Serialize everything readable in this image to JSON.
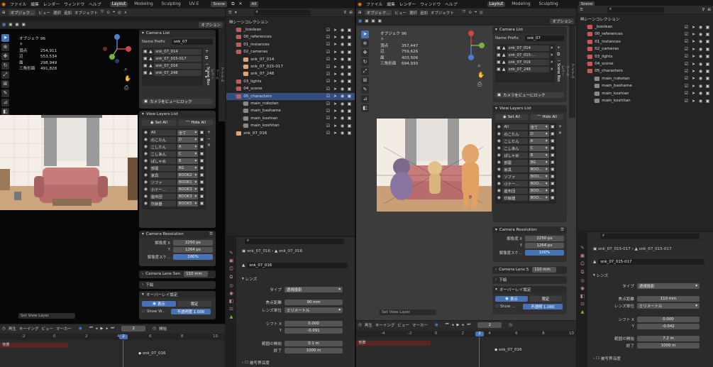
{
  "left": {
    "menu": [
      "ファイル",
      "編集",
      "レンダー",
      "ウィンドウ",
      "ヘルプ"
    ],
    "workspaces": [
      "Layout",
      "Modeling",
      "Sculpting",
      "UV E"
    ],
    "scene": "Scene",
    "view_layer": "All",
    "viewport_header": {
      "mode": "オブジェク...",
      "items": [
        "ビュー",
        "選択",
        "追加",
        "オブジェクト"
      ],
      "options": "オプション"
    },
    "stats": [
      [
        "オブジェクト",
        "96"
      ],
      [
        "頂点",
        "254,911"
      ],
      [
        "辺",
        "553,534"
      ],
      [
        "面",
        "298,949"
      ],
      [
        "三角形面",
        "491,828"
      ]
    ],
    "camera_list": {
      "title": "Camera List",
      "prefix_label": "Name Prefix",
      "prefix_value": "snk_07",
      "items": [
        "snk_07_014",
        "snk_07_015-017",
        "snk_07_016",
        "snk_07_248"
      ],
      "lock_button": "カメラをビューにロック"
    },
    "view_layers": {
      "title": "View Layers List",
      "set_all": "Set All",
      "hide_all": "Hide All",
      "items": [
        [
          "All",
          "全て"
        ],
        [
          "のこたん",
          "D"
        ],
        [
          "こしたん",
          "A"
        ],
        [
          "こしあん",
          "C"
        ],
        [
          "ぱしゃめ",
          "B"
        ],
        [
          "部屋",
          "BG"
        ],
        [
          "家具",
          "BOOK2"
        ],
        [
          "ソファ",
          "BOOK1"
        ],
        [
          "小テー...",
          "BOOK3"
        ],
        [
          "座布団",
          "BOOK3"
        ],
        [
          "炊飯器",
          "BOOK5"
        ]
      ]
    },
    "camera_resolution": {
      "title": "Camera Resolution",
      "res_x_label": "解像度 X",
      "res_x": "2250 px",
      "res_y_label": "Y",
      "res_y": "1264 px",
      "scale_label": "解像度スケ...",
      "scale": "100%"
    },
    "lens_sensor": {
      "label": "Camera Lens Sen",
      "value": "110 mm"
    },
    "shita": "下絵",
    "overlay": {
      "title": "オーバーレイ設定",
      "show": "表示",
      "limit": "限定",
      "show_w": "Show W...",
      "opacity": "不透明度 1.000"
    },
    "set_view_layer": "Set View Layer",
    "side_tabs": [
      "アイテム",
      "ツール",
      "ビュー",
      "Scene Box"
    ],
    "outliner": {
      "title": "シーンコレクション",
      "rows": [
        "_boolean",
        "00_references",
        "01_instances",
        "02_cameras",
        "snk_07_014",
        "snk_07_015-017",
        "snk_07_248",
        "03_lights",
        "04_scene",
        "05_characters",
        "main_nokotan",
        "main_bashame",
        "main_koshian",
        "main_koshitan",
        "snk_07_016"
      ]
    },
    "props": {
      "breadcrumb1": "snk_07_016",
      "breadcrumb2": "snk_07_016",
      "name": "snk_07_016",
      "lens_section": "レンズ",
      "type_label": "タイプ",
      "type_value": "透視投影",
      "focal_label": "焦点距離",
      "focal_value": "90 mm",
      "unit_label": "レンズ単位",
      "unit_value": "ミリメートル",
      "shift_label": "シフト X",
      "shift_x": "0.000",
      "y_label": "Y",
      "shift_y": "-0.091",
      "clip_start_label": "範囲の開始",
      "clip_start": "0.1 m",
      "clip_end_label": "終了",
      "clip_end": "1000 m",
      "dof": "被写界深度"
    },
    "timeline": {
      "items": [
        "再生",
        "キーイング",
        "ビュー",
        "マーカー"
      ],
      "frame": "2",
      "start": "開始",
      "marker_label": "snk_07_016",
      "track": "背景",
      "ticks": [
        "-2",
        "0",
        "2",
        "4",
        "6",
        "8",
        "10"
      ]
    }
  },
  "right": {
    "menu": [
      "ファイル",
      "編集",
      "レンダー",
      "ウィンドウ",
      "ヘルプ"
    ],
    "workspaces": [
      "Layout",
      "Modeling",
      "Sculpting"
    ],
    "scene": "Scene",
    "viewport_header": {
      "mode": "オブジェク...",
      "items": [
        "ビュー",
        "選択",
        "追加",
        "オブジェクト"
      ],
      "options": "オプション"
    },
    "stats": [
      [
        "オブジェクト",
        "96"
      ],
      [
        "頂点",
        "357,447"
      ],
      [
        "辺",
        "759,626"
      ],
      [
        "面",
        "403,506"
      ],
      [
        "三角形面",
        "694,930"
      ]
    ],
    "camera_list": {
      "title": "Camera List",
      "prefix_label": "Name Prefix",
      "prefix_value": "snk_07",
      "items": [
        "snk_07_014",
        "snk_07_015-...",
        "snk_07_016",
        "snk_07_248"
      ],
      "lock_button": "カメラをビューにロック"
    },
    "view_layers": {
      "title": "View Layers List",
      "set_all": "Set All",
      "hide_all": "Hide All",
      "items": [
        [
          "All",
          "全て"
        ],
        [
          "のこたん",
          "D"
        ],
        [
          "こしたん",
          "A"
        ],
        [
          "こしあん",
          "C"
        ],
        [
          "ぱしゃめ",
          "B"
        ],
        [
          "部屋",
          "BG"
        ],
        [
          "家具",
          "BOO..."
        ],
        [
          "ソファ",
          "BOO..."
        ],
        [
          "小テー...",
          "BOO..."
        ],
        [
          "座布団",
          "BOO..."
        ],
        [
          "炊飯器",
          "BOO..."
        ]
      ]
    },
    "camera_resolution": {
      "title": "Camera Resolution",
      "res_x_label": "解像度 X",
      "res_x": "2250 px",
      "res_y_label": "Y",
      "res_y": "1264 px",
      "scale_label": "解像度スケ...",
      "scale": "100%"
    },
    "lens_sensor": {
      "label": "Camera Lens S",
      "value": "110 mm"
    },
    "shita": "下絵",
    "overlay": {
      "title": "オーバーレイ設定",
      "show": "表示",
      "limit": "限定",
      "show_w": "Show ...",
      "opacity": "不透明 1.000"
    },
    "set_view_layer": "Set View Layer",
    "side_tabs": [
      "アイテム",
      "ツール",
      "ビュー",
      "Scene Box"
    ],
    "outliner": {
      "title": "シーンコレクション",
      "rows": [
        "_boolean",
        "00_references",
        "01_instances",
        "02_cameras",
        "03_lights",
        "04_scene",
        "05_characters",
        "main_nokotan",
        "main_bashame",
        "main_koshian",
        "main_koshitan"
      ]
    },
    "props": {
      "breadcrumb1": "snk_07_015-017",
      "breadcrumb2": "snk_07_015-017",
      "name": "snk_07_015-017",
      "lens_section": "レンズ",
      "type_label": "タイプ",
      "type_value": "透視投影",
      "focal_label": "焦点距離",
      "focal_value": "110 mm",
      "unit_label": "レンズ単位",
      "unit_value": "ミリメートル",
      "shift_label": "シフト X",
      "shift_x": "0.000",
      "y_label": "Y",
      "shift_y": "-0.042",
      "clip_start_label": "範囲の開始",
      "clip_start": "7.2 m",
      "clip_end_label": "終了",
      "clip_end": "1000 m",
      "dof": "被写界深度"
    },
    "timeline": {
      "items": [
        "再生",
        "キーイング",
        "ビュー",
        "マーカー"
      ],
      "frame": "2",
      "marker_label": "snk_07_016",
      "track": "背景",
      "ticks": [
        "-4",
        "-2",
        "0",
        "2",
        "4",
        "6",
        "8",
        "10"
      ]
    }
  },
  "colors": {
    "accent": "#4772b3",
    "selected_row": "#334d80",
    "track": "#5a2525"
  }
}
